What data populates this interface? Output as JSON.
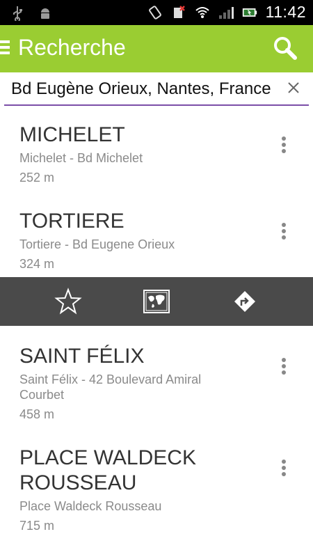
{
  "status_bar": {
    "time": "11:42",
    "icons": [
      "usb-icon",
      "android-debug-icon",
      "vibrate-icon",
      "no-sim-icon",
      "wifi-icon",
      "signal-icon",
      "battery-icon"
    ]
  },
  "action_bar": {
    "title": "Recherche",
    "color": "#9acd32",
    "icons": [
      "menu-icon",
      "search-icon"
    ]
  },
  "search": {
    "value": "Bd Eugène Orieux, Nantes, France",
    "underline_color": "#7b4ea8"
  },
  "results": [
    {
      "name": "MICHELET",
      "address": "Michelet - Bd Michelet",
      "distance": "252 m"
    },
    {
      "name": "TORTIERE",
      "address": "Tortiere - Bd Eugene Orieux",
      "distance": "324 m"
    },
    {
      "name": "SAINT FÉLIX",
      "address": "Saint Félix - 42 Boulevard Amiral Courbet",
      "distance": "458 m"
    },
    {
      "name": "PLACE WALDECK ROUSSEAU",
      "address": "Place Waldeck Rousseau",
      "distance": "715 m"
    }
  ],
  "quick_actions": [
    "star-icon",
    "map-icon",
    "directions-icon"
  ]
}
